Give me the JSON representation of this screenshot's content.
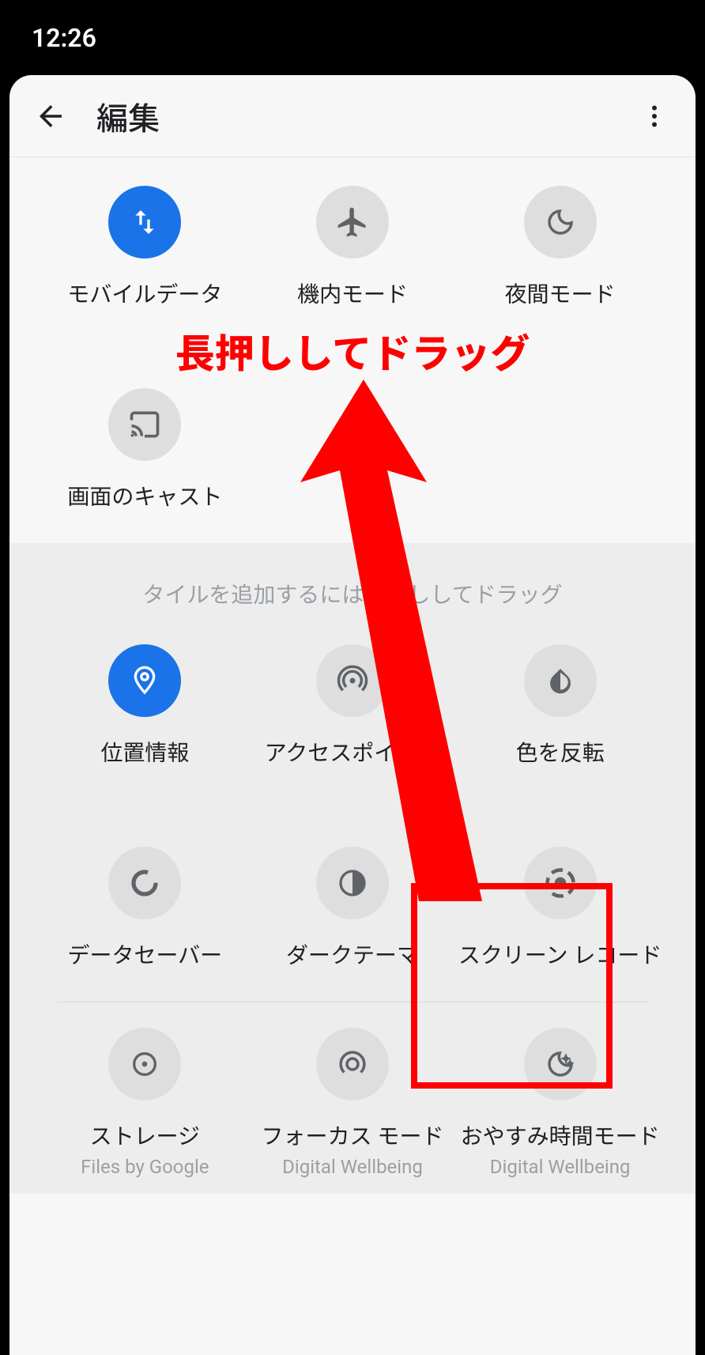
{
  "status": {
    "time": "12:26"
  },
  "appbar": {
    "title": "編集"
  },
  "annotation": {
    "text": "長押ししてドラッグ"
  },
  "hint": "タイルを追加するには長押ししてドラッグ",
  "active_tiles": [
    {
      "label": "モバイルデータ"
    },
    {
      "label": "機内モード"
    },
    {
      "label": "夜間モード"
    },
    {
      "label": "画面のキャスト"
    }
  ],
  "available_tiles_r1": [
    {
      "label": "位置情報"
    },
    {
      "label": "アクセスポイント"
    },
    {
      "label": "色を反転"
    }
  ],
  "available_tiles_r2": [
    {
      "label": "データセーバー"
    },
    {
      "label": "ダークテーマ"
    },
    {
      "label": "スクリーン レコード"
    }
  ],
  "available_tiles_r3": [
    {
      "label": "ストレージ",
      "sub": "Files by Google"
    },
    {
      "label": "フォーカス モード",
      "sub": "Digital Wellbeing"
    },
    {
      "label": "おやすみ時間モード",
      "sub": "Digital Wellbeing"
    }
  ]
}
